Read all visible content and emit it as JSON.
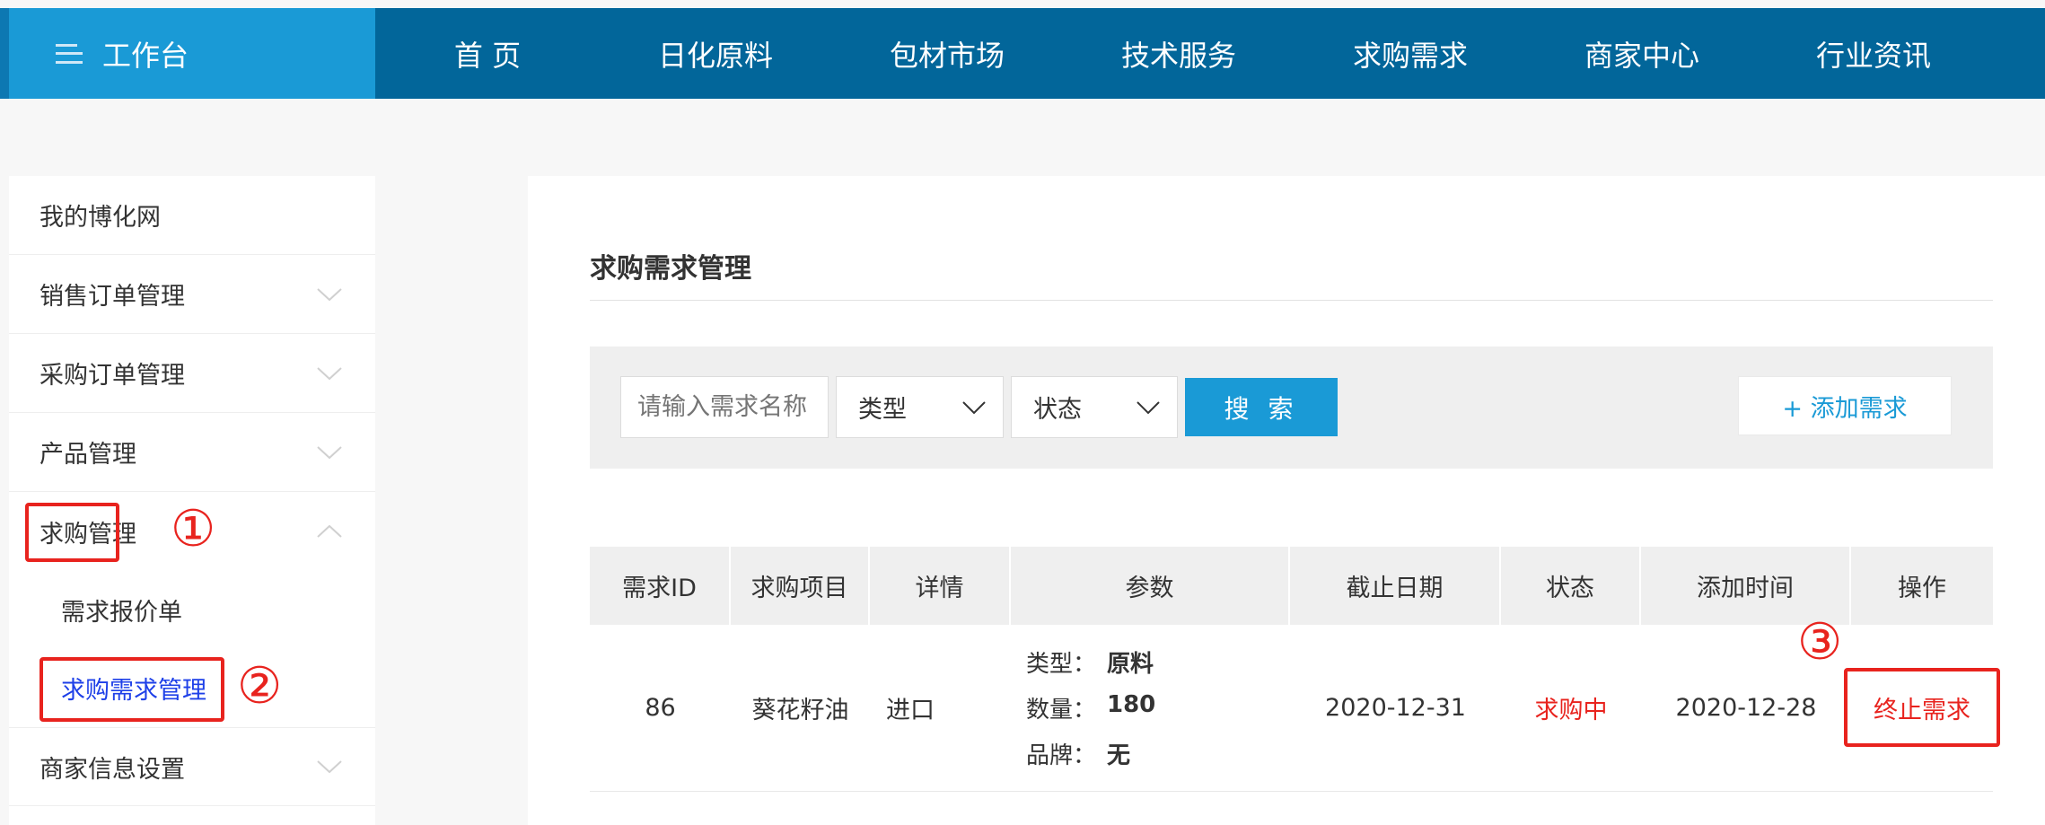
{
  "topbar": {
    "workbench_label": "工作台",
    "nav": [
      "首 页",
      "日化原料",
      "包材市场",
      "技术服务",
      "求购需求",
      "商家中心",
      "行业资讯"
    ]
  },
  "sidebar": {
    "items": [
      {
        "label": "我的博化网",
        "chevron": ""
      },
      {
        "label": "销售订单管理",
        "chevron": "down"
      },
      {
        "label": "采购订单管理",
        "chevron": "down"
      },
      {
        "label": "产品管理",
        "chevron": "down"
      },
      {
        "label": "求购管理",
        "chevron": "up"
      }
    ],
    "sub_items": [
      {
        "label": "需求报价单"
      },
      {
        "label": "求购需求管理"
      }
    ],
    "after_items": [
      {
        "label": "商家信息设置",
        "chevron": "down"
      }
    ]
  },
  "annotations": {
    "n1": "①",
    "n2": "②",
    "n3": "③",
    "color": "#e8231e"
  },
  "main": {
    "title": "求购需求管理",
    "filter": {
      "search_placeholder": "请输入需求名称",
      "type_label": "类型",
      "status_label": "状态",
      "search_button": "搜 索",
      "add_button": "+ 添加需求"
    },
    "table": {
      "headers": [
        "需求ID",
        "求购项目",
        "详情",
        "参数",
        "截止日期",
        "状态",
        "添加时间",
        "操作"
      ],
      "rows": [
        {
          "id": "86",
          "project": "葵花籽油",
          "detail": "进口",
          "params": [
            {
              "k": "类型：",
              "v": "原料"
            },
            {
              "k": "数量：",
              "v": "180"
            },
            {
              "k": "品牌：",
              "v": "无"
            }
          ],
          "deadline": "2020-12-31",
          "status": "求购中",
          "added": "2020-12-28",
          "action": "终止需求"
        }
      ]
    }
  },
  "colors": {
    "nav_bg": "#02669a",
    "workbench_bg": "#1a9ad6",
    "accent": "#1a9ad6",
    "active_link": "#1e40e8",
    "alert": "#e8231e"
  },
  "icons": {
    "menu": "menu-icon",
    "chevron_down": "chevron-down-icon",
    "chevron_up": "chevron-up-icon"
  }
}
